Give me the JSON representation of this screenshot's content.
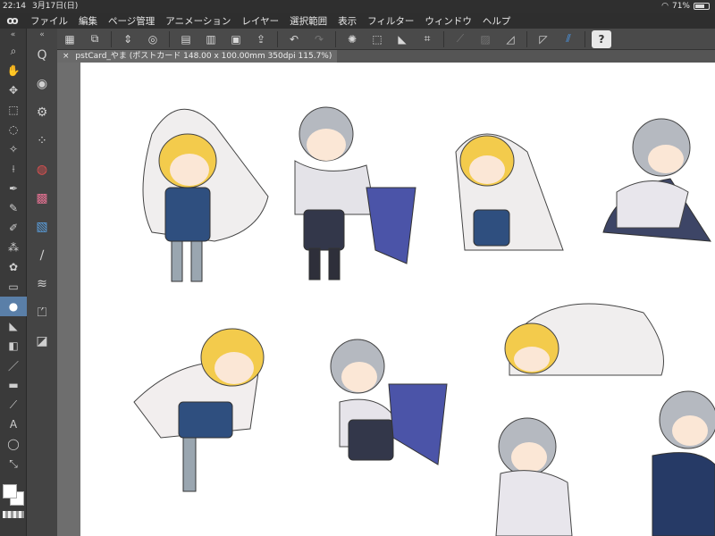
{
  "status": {
    "time": "22:14",
    "date": "3月17日(日)",
    "battery": "71%",
    "battery_level": 0.71
  },
  "menu": {
    "items": [
      "ファイル",
      "編集",
      "ページ管理",
      "アニメーション",
      "レイヤー",
      "選択範囲",
      "表示",
      "フィルター",
      "ウィンドウ",
      "ヘルプ"
    ]
  },
  "document": {
    "tab_title": "pstCard_やま (ポストカード 148.00 x 100.00mm 350dpi 115.7%)",
    "close_glyph": "×"
  },
  "toolbar": {
    "icons": [
      "grid-icon",
      "layer-arrange-icon",
      "spinner-icon",
      "spiral-icon",
      "save-icon",
      "open-icon",
      "new-icon",
      "share-icon",
      "undo-icon",
      "redo-icon",
      "sparkle-icon",
      "transform-icon",
      "fill-icon",
      "crop-icon",
      "ruler-icon",
      "snap-icon",
      "special-ruler-icon",
      "perspective-icon",
      "blue-ruler-icon",
      "help-icon"
    ]
  },
  "tools": {
    "collapse_label": "«",
    "left": [
      "magnifier-icon",
      "hand-icon",
      "move-icon",
      "selection-icon",
      "lasso-icon",
      "auto-select-icon",
      "eyedropper-icon",
      "pen-icon",
      "pencil-icon",
      "brush-icon",
      "airbrush-icon",
      "decoration-icon",
      "eraser-icon",
      "blend-icon",
      "fill-icon",
      "gradient-icon",
      "figure-icon",
      "frame-icon",
      "ruler-icon",
      "text-icon",
      "balloon-icon",
      "line-correction-icon"
    ],
    "active_index": 13,
    "sub": [
      "zoom-in-icon",
      "water-drop-icon",
      "gear-drop-icon",
      "drops-icon",
      "color-wheel-icon",
      "color-slider-icon",
      "color-set-icon",
      "brush-size-icon",
      "layer-property-icon",
      "clapper-icon",
      "layer-icon"
    ]
  },
  "colors": {
    "accent": "#5a7fa8",
    "blue_icon": "#4aa3ff",
    "foreground": "#ffffff",
    "background": "#ffffff"
  }
}
